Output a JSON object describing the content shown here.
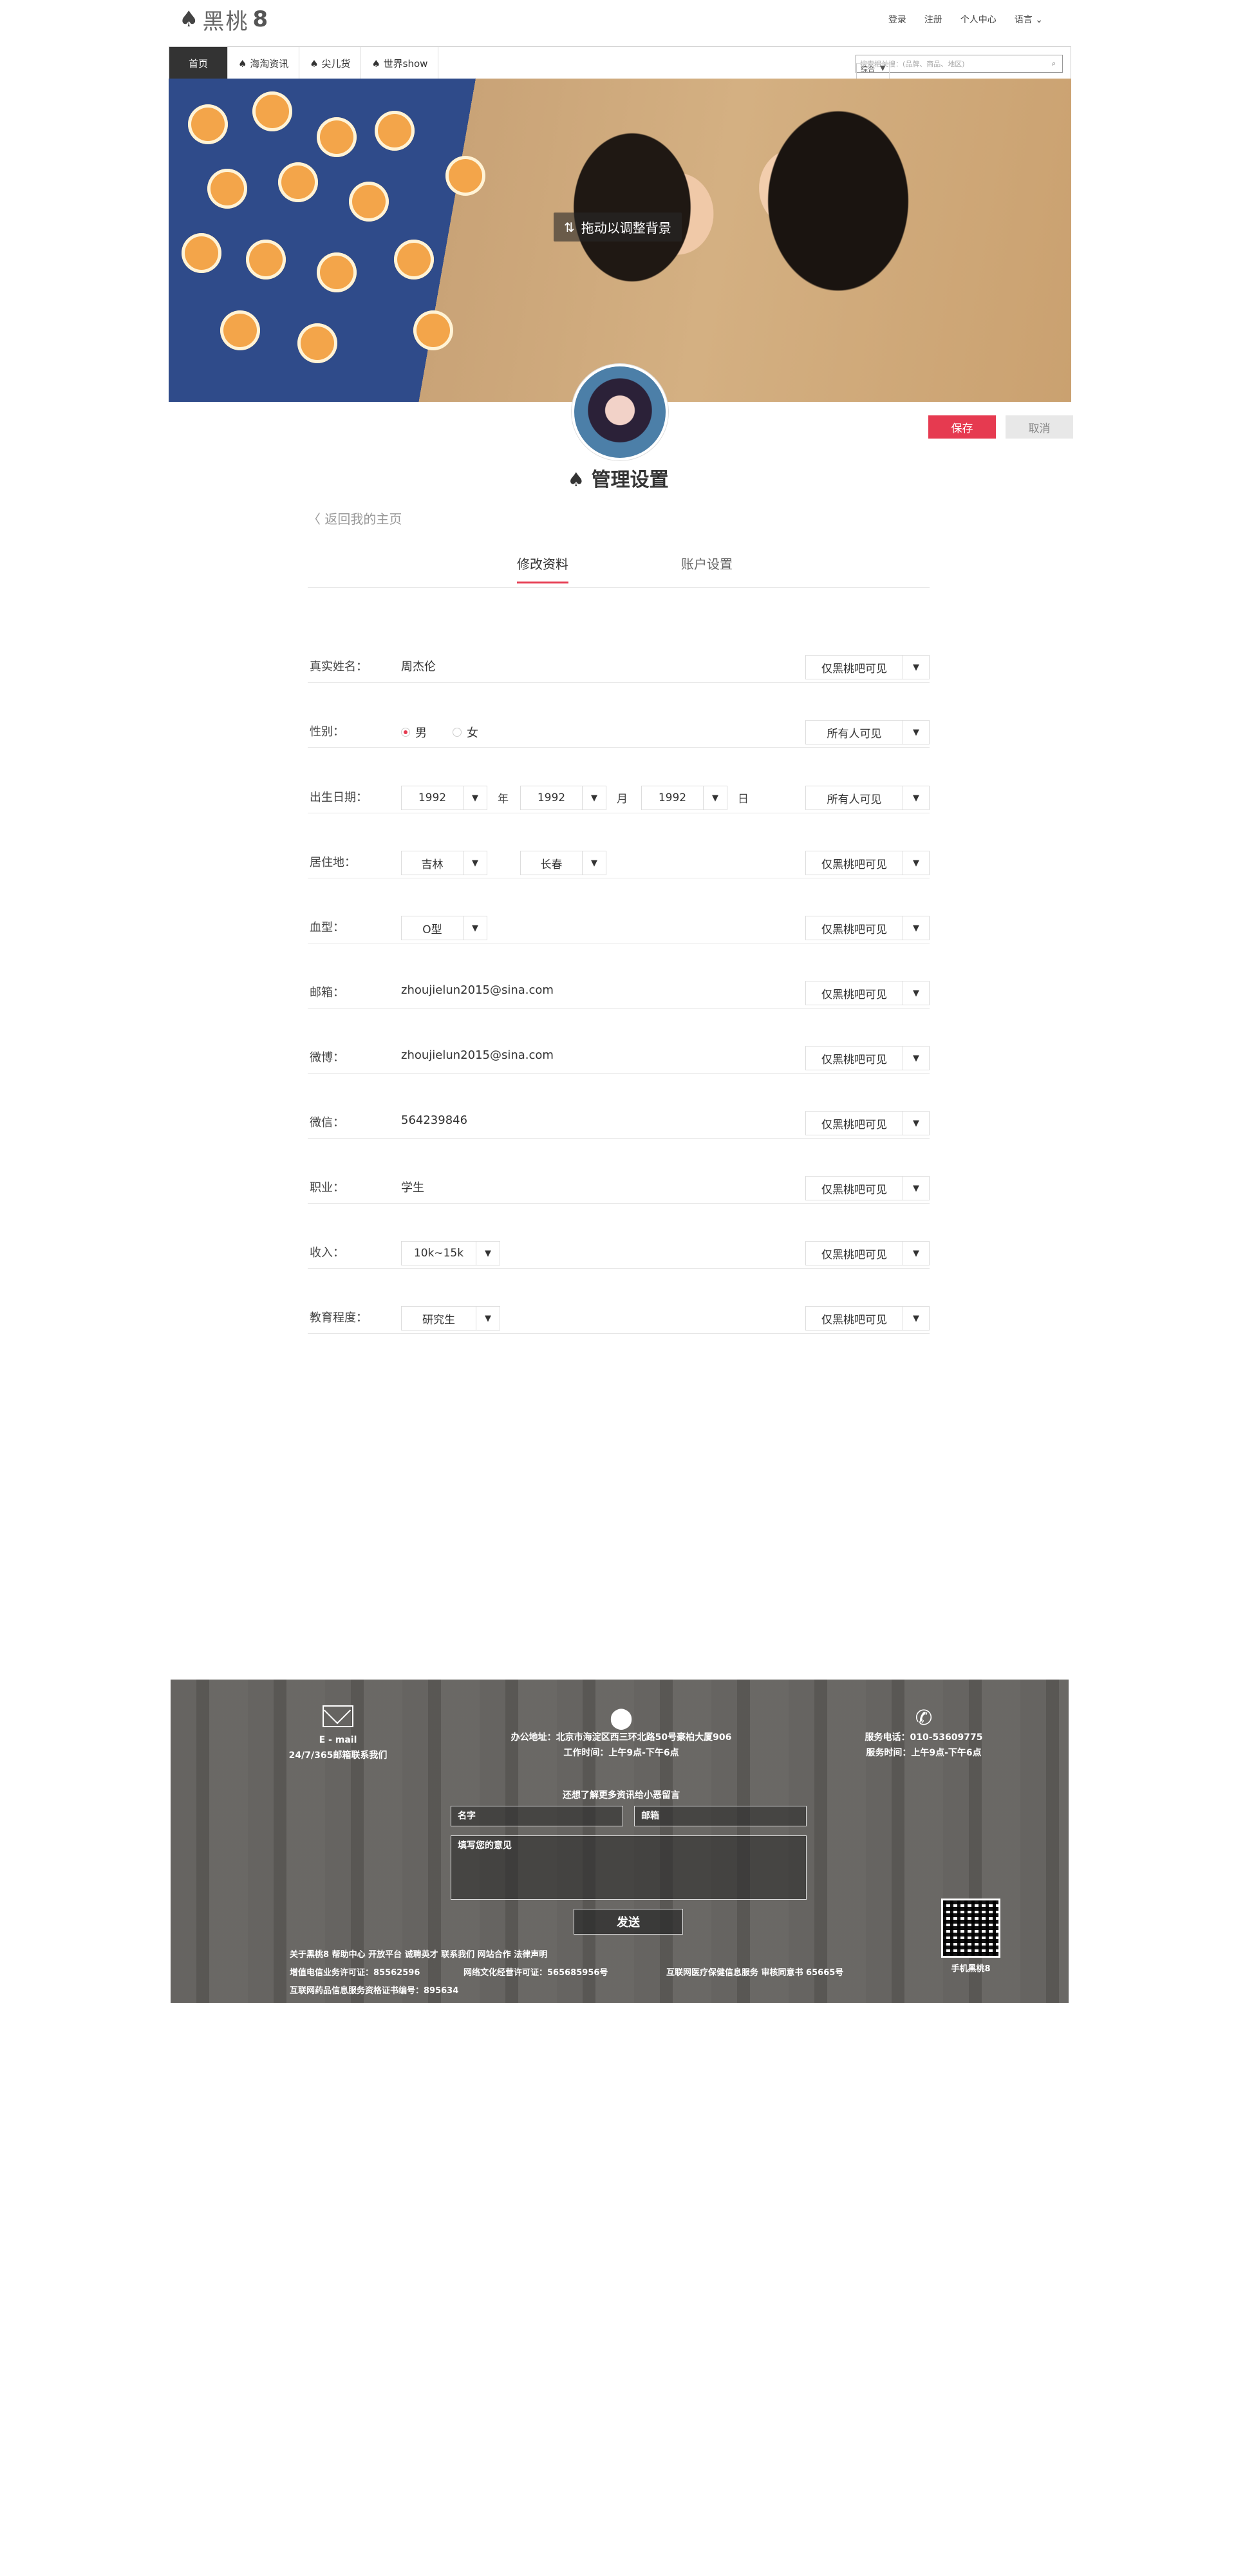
{
  "brand": {
    "logo_text": "黑桃",
    "logo_num": "8"
  },
  "topnav": {
    "login": "登录",
    "register": "注册",
    "user_center": "个人中心",
    "lang": "语言"
  },
  "nav": {
    "tabs": [
      "首页",
      "♠ 海淘资讯",
      "♠ 尖儿货",
      "♠ 世界show"
    ],
    "search_placeholder": "搜索相关搜：(品牌、商品、地区)",
    "search_scope": "综合"
  },
  "banner": {
    "drag_hint": "拖动以调整背景"
  },
  "actions": {
    "save": "保存",
    "cancel": "取消"
  },
  "page": {
    "title": "管理设置",
    "back_link": "返回我的主页"
  },
  "tabs": {
    "profile": "修改资料",
    "account": "账户设置"
  },
  "form": {
    "name": {
      "label": "真实姓名：",
      "value": "周杰伦",
      "vis": "仅黑桃吧可见"
    },
    "gender": {
      "label": "性别：",
      "male": "男",
      "female": "女",
      "vis": "所有人可见"
    },
    "birth": {
      "label": "出生日期：",
      "year": "1992",
      "month": "1992",
      "day": "1992",
      "u_year": "年",
      "u_month": "月",
      "u_day": "日",
      "vis": "所有人可见"
    },
    "residence": {
      "label": "居住地：",
      "province": "吉林",
      "city": "长春",
      "vis": "仅黑桃吧可见"
    },
    "blood": {
      "label": "血型：",
      "value": "O型",
      "vis": "仅黑桃吧可见"
    },
    "email": {
      "label": "邮箱：",
      "value": "zhoujielun2015@sina.com",
      "vis": "仅黑桃吧可见"
    },
    "weibo": {
      "label": "微博：",
      "value": "zhoujielun2015@sina.com",
      "vis": "仅黑桃吧可见"
    },
    "wechat": {
      "label": "微信：",
      "value": "564239846",
      "vis": "仅黑桃吧可见"
    },
    "job": {
      "label": "职业：",
      "value": "学生",
      "vis": "仅黑桃吧可见"
    },
    "income": {
      "label": "收入：",
      "value": "10k~15k",
      "vis": "仅黑桃吧可见"
    },
    "education": {
      "label": "教育程度：",
      "value": "研究生",
      "vis": "仅黑桃吧可见"
    }
  },
  "footer": {
    "mail_title": "E - mail",
    "mail_sub": "24/7/365邮箱联系我们",
    "office_title": "办公地址：北京市海淀区西三环北路50号豪柏大厦906",
    "office_sub": "工作时间：上午9点-下午6点",
    "phone_title": "服务电话：010-53609775",
    "phone_sub": "服务时间：上午9点-下午6点",
    "msg_title": "还想了解更多资讯给小恶留言",
    "name_ph": "名字",
    "email_ph": "邮箱",
    "msg_ph": "填写您的意见",
    "send": "发送",
    "links": "关于黑桃8  帮助中心  开放平台  诚聘英才  联系我们  网站合作  法律声明",
    "icp1": "增值电信业务许可证：85562596",
    "icp2": "网络文化经营许可证：565685956号",
    "icp3": "互联网医疗保健信息服务 审核同意书 65665号",
    "icp4": "互联网药品信息服务资格证书编号：895634",
    "app": "手机黑桃8"
  }
}
